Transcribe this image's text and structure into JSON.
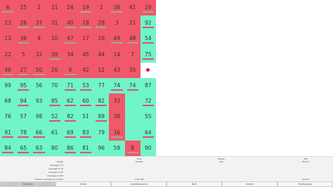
{
  "colors": {
    "red": "#f15869",
    "green": "#6ff5c8",
    "marker": "#e21b2a"
  },
  "board": {
    "rows": [
      [
        {
          "n": "6",
          "c": "red",
          "bar": true
        },
        {
          "n": "15",
          "c": "red",
          "bar": false
        },
        {
          "n": "2",
          "c": "red",
          "bar": false
        },
        {
          "n": "11",
          "c": "red",
          "bar": false
        },
        {
          "n": "24",
          "c": "red",
          "bar": false
        },
        {
          "n": "19",
          "c": "red",
          "bar": true
        },
        {
          "n": "1",
          "c": "red",
          "bar": false
        },
        {
          "n": "38",
          "c": "red",
          "bar": true
        },
        {
          "n": "41",
          "c": "red",
          "bar": false
        },
        {
          "n": "29",
          "c": "red",
          "bar": true
        }
      ],
      [
        {
          "n": "23",
          "c": "red",
          "bar": false
        },
        {
          "n": "26",
          "c": "red",
          "bar": true
        },
        {
          "n": "37",
          "c": "red",
          "bar": true
        },
        {
          "n": "31",
          "c": "red",
          "bar": false
        },
        {
          "n": "40",
          "c": "red",
          "bar": true
        },
        {
          "n": "18",
          "c": "red",
          "bar": true
        },
        {
          "n": "28",
          "c": "red",
          "bar": true
        },
        {
          "n": "3",
          "c": "red",
          "bar": false
        },
        {
          "n": "21",
          "c": "red",
          "bar": false
        },
        {
          "n": "92",
          "c": "green",
          "bar": true
        }
      ],
      [
        {
          "n": "13",
          "c": "red",
          "bar": false
        },
        {
          "n": "36",
          "c": "red",
          "bar": true
        },
        {
          "n": "4",
          "c": "red",
          "bar": false
        },
        {
          "n": "10",
          "c": "red",
          "bar": false
        },
        {
          "n": "47",
          "c": "red",
          "bar": true
        },
        {
          "n": "17",
          "c": "red",
          "bar": false
        },
        {
          "n": "16",
          "c": "red",
          "bar": false
        },
        {
          "n": "49",
          "c": "red",
          "bar": true
        },
        {
          "n": "48",
          "c": "red",
          "bar": true
        },
        {
          "n": "54",
          "c": "green",
          "bar": true
        }
      ],
      [
        {
          "n": "22",
          "c": "red",
          "bar": false
        },
        {
          "n": "5",
          "c": "red",
          "bar": false
        },
        {
          "n": "32",
          "c": "red",
          "bar": false
        },
        {
          "n": "39",
          "c": "red",
          "bar": true
        },
        {
          "n": "34",
          "c": "red",
          "bar": false
        },
        {
          "n": "45",
          "c": "red",
          "bar": false
        },
        {
          "n": "44",
          "c": "red",
          "bar": false
        },
        {
          "n": "14",
          "c": "red",
          "bar": false
        },
        {
          "n": "7",
          "c": "red",
          "bar": false
        },
        {
          "n": "75",
          "c": "green",
          "bar": true
        }
      ],
      [
        {
          "n": "46",
          "c": "red",
          "bar": true
        },
        {
          "n": "27",
          "c": "red",
          "bar": true
        },
        {
          "n": "50",
          "c": "red",
          "bar": true
        },
        {
          "n": "20",
          "c": "red",
          "bar": false
        },
        {
          "n": "9",
          "c": "red",
          "bar": true
        },
        {
          "n": "42",
          "c": "red",
          "bar": false
        },
        {
          "n": "12",
          "c": "red",
          "bar": false
        },
        {
          "n": "43",
          "c": "red",
          "bar": false
        },
        {
          "n": "35",
          "c": "red",
          "bar": false
        },
        {
          "n": "",
          "c": "empty",
          "bar": false,
          "dot": true
        }
      ],
      [
        {
          "n": "99",
          "c": "green",
          "bar": false
        },
        {
          "n": "95",
          "c": "green",
          "bar": true
        },
        {
          "n": "56",
          "c": "green",
          "bar": false
        },
        {
          "n": "70",
          "c": "green",
          "bar": false
        },
        {
          "n": "71",
          "c": "green",
          "bar": true
        },
        {
          "n": "53",
          "c": "green",
          "bar": true
        },
        {
          "n": "77",
          "c": "green",
          "bar": false
        },
        {
          "n": "74",
          "c": "green",
          "bar": true
        },
        {
          "n": "74",
          "c": "green",
          "bar": true
        },
        {
          "n": "87",
          "c": "green",
          "bar": false
        }
      ],
      [
        {
          "n": "68",
          "c": "green",
          "bar": false
        },
        {
          "n": "94",
          "c": "green",
          "bar": true
        },
        {
          "n": "93",
          "c": "green",
          "bar": false
        },
        {
          "n": "85",
          "c": "green",
          "bar": true
        },
        {
          "n": "62",
          "c": "green",
          "bar": true
        },
        {
          "n": "60",
          "c": "green",
          "bar": true
        },
        {
          "n": "82",
          "c": "green",
          "bar": true
        },
        {
          "n": "33",
          "c": "red",
          "bar": false
        },
        {
          "n": "72",
          "c": "green",
          "bar": true
        }
      ],
      [
        {
          "n": "76",
          "c": "green",
          "bar": false
        },
        {
          "n": "57",
          "c": "green",
          "bar": false
        },
        {
          "n": "98",
          "c": "green",
          "bar": false
        },
        {
          "n": "52",
          "c": "green",
          "bar": true
        },
        {
          "n": "82",
          "c": "green",
          "bar": true
        },
        {
          "n": "51",
          "c": "green",
          "bar": false
        },
        {
          "n": "89",
          "c": "green",
          "bar": true
        },
        {
          "n": "30",
          "c": "red",
          "bar": false
        },
        {
          "n": "55",
          "c": "green",
          "bar": false
        }
      ],
      [
        {
          "n": "91",
          "c": "green",
          "bar": true
        },
        {
          "n": "78",
          "c": "green",
          "bar": true
        },
        {
          "n": "66",
          "c": "green",
          "bar": true
        },
        {
          "n": "61",
          "c": "green",
          "bar": false
        },
        {
          "n": "69",
          "c": "green",
          "bar": true
        },
        {
          "n": "83",
          "c": "green",
          "bar": true
        },
        {
          "n": "79",
          "c": "green",
          "bar": false
        },
        {
          "n": "16",
          "c": "red",
          "bar": true
        },
        {
          "n": "64",
          "c": "green",
          "bar": true
        }
      ],
      [
        {
          "n": "84",
          "c": "green",
          "bar": true
        },
        {
          "n": "65",
          "c": "green",
          "bar": true
        },
        {
          "n": "63",
          "c": "green",
          "bar": true
        },
        {
          "n": "80",
          "c": "green",
          "bar": false
        },
        {
          "n": "86",
          "c": "green",
          "bar": true
        },
        {
          "n": "81",
          "c": "green",
          "bar": true
        },
        {
          "n": "96",
          "c": "green",
          "bar": false
        },
        {
          "n": "59",
          "c": "green",
          "bar": false
        },
        {
          "n": "8",
          "c": "red",
          "bar": true
        },
        {
          "n": "90",
          "c": "green",
          "bar": false
        }
      ]
    ]
  },
  "stats": {
    "headers": [
      "Time",
      "Moves",
      "TPS"
    ],
    "rows": [
      {
        "label": "Single",
        "values": [
          "16.384",
          "411",
          "25.071"
        ]
      },
      {
        "label": "Average of 5",
        "values": [
          "",
          "",
          ""
        ]
      },
      {
        "label": "Average of 12",
        "values": [
          "",
          "",
          ""
        ]
      },
      {
        "label": "Average of 50",
        "values": [
          "",
          "",
          ""
        ]
      },
      {
        "label": "Average of 100",
        "values": [
          "",
          "",
          ""
        ]
      },
      {
        "label": "Session average (9 solves)",
        "values": [
          "1:49.790",
          "",
          "16.417"
        ]
      }
    ]
  },
  "buttons": [
    {
      "label": "Settings",
      "active": true
    },
    {
      "label": "Stats",
      "active": false
    },
    {
      "label": "Leaderboards",
      "active": false
    },
    {
      "label": "BLD",
      "active": false
    },
    {
      "label": "Solver",
      "active": false
    },
    {
      "label": "Multiplayer",
      "active": false
    }
  ]
}
